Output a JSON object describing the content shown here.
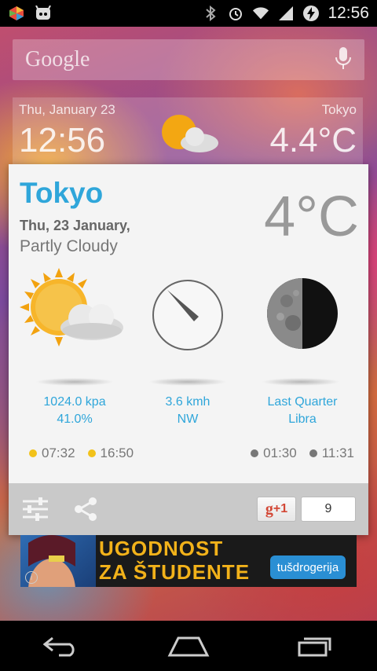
{
  "status_bar": {
    "time": "12:56",
    "left_icons": [
      "notification-app-icon",
      "cyanogen-icon"
    ],
    "right_icons": [
      "bluetooth-icon",
      "alarm-icon",
      "wifi-icon",
      "signal-icon",
      "battery-charging-icon"
    ]
  },
  "search": {
    "logo_text": "Google",
    "mic_icon": "mic-icon"
  },
  "clock_widget": {
    "date": "Thu, January 23",
    "city": "Tokyo",
    "time": "12:56",
    "temp": "4.4°C"
  },
  "weather": {
    "city": "Tokyo",
    "date": "Thu, 23 January,",
    "condition": "Partly Cloudy",
    "temp": "4°C",
    "pressure": "1024.0 kpa",
    "humidity": "41.0%",
    "wind_speed": "3.6 kmh",
    "wind_dir": "NW",
    "moon_phase": "Last Quarter",
    "zodiac": "Libra",
    "sunrise": "07:32",
    "sunset": "16:50",
    "moonrise": "01:30",
    "moonset": "11:31",
    "accent_color": "#2fa6da"
  },
  "footer": {
    "gplus_label": "+1",
    "gplus_count": "9"
  },
  "ad": {
    "line1": "UGODNOST",
    "line2": "ZA ŠTUDENTE",
    "brand": "tušdrogerija"
  }
}
